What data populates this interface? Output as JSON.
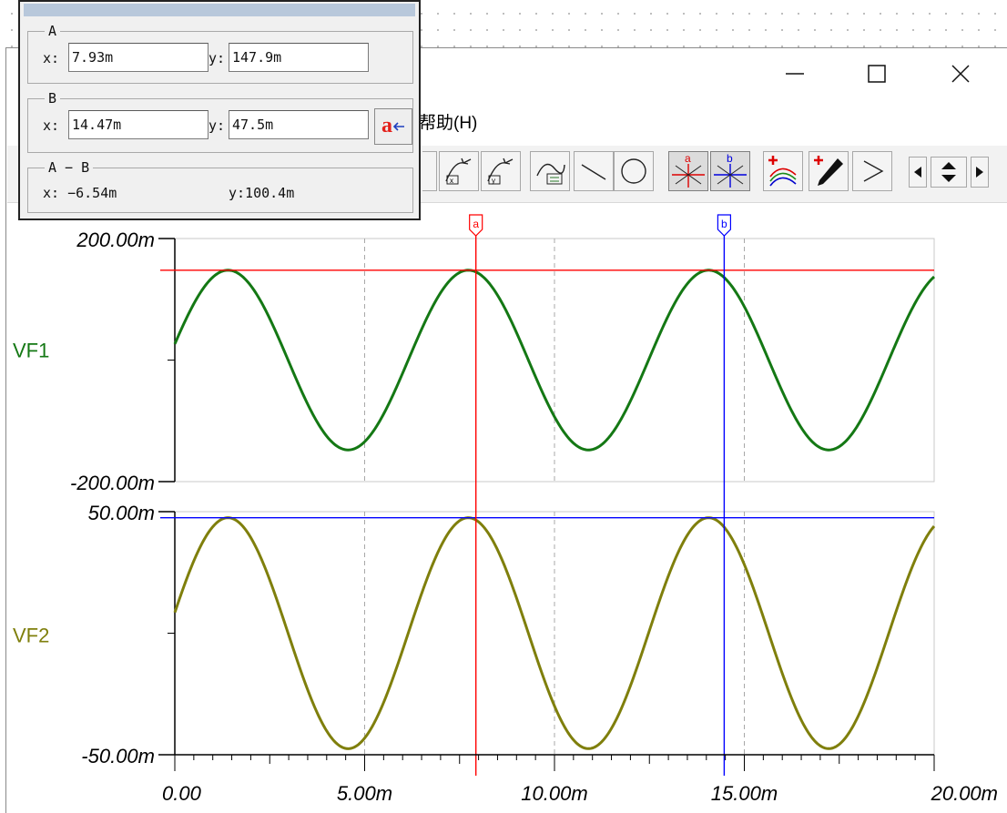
{
  "window": {
    "menu_help": "帮助(H)",
    "minimize_icon": "minimize-icon",
    "maximize_icon": "maximize-icon",
    "close_icon": "close-icon"
  },
  "toolbar": {
    "buttons": [
      "cut-x-icon",
      "cut-y-icon",
      "approx-icon",
      "line-icon",
      "circle-icon",
      "cursor-a-icon",
      "cursor-b-icon",
      "add-trace-icon",
      "probe-icon",
      "play-icon"
    ]
  },
  "cursor_readout": {
    "a": {
      "title": "A",
      "x_label": "x:",
      "x_value": "7.93m",
      "y_label": "y:",
      "y_value": "147.9m"
    },
    "b": {
      "title": "B",
      "x_label": "x:",
      "x_value": "14.47m",
      "y_label": "y:",
      "y_value": "47.5m"
    },
    "diff": {
      "title": "A − B",
      "x_text": "x: −6.54m",
      "y_text": "y:100.4m"
    },
    "set_cursor_label": "a",
    "colors": {
      "label": "#e3201b",
      "arrow": "#1f3fbf"
    }
  },
  "chart_data": {
    "type": "line",
    "x_unit": "s",
    "x_ticks": [
      "0.00",
      "5.00m",
      "10.00m",
      "15.00m",
      "20.00m"
    ],
    "xlim": [
      0,
      0.02
    ],
    "cursors": [
      {
        "name": "a",
        "x": 0.00793,
        "color": "#ff0000",
        "level_VF1": 0.1479
      },
      {
        "name": "b",
        "x": 0.01447,
        "color": "#0000ff",
        "level_VF2": 0.0475
      }
    ],
    "panels": [
      {
        "series": "VF1",
        "color": "#147814",
        "ylim": [
          -0.2,
          0.2
        ],
        "y_ticks": [
          "200.00m",
          "-200.00m"
        ],
        "amplitude": 0.1479,
        "frequency_hz": 158,
        "phase_rad": 0.18,
        "x": [
          0,
          0.001,
          0.002,
          0.003,
          0.004,
          0.005,
          0.006,
          0.007,
          0.008,
          0.009,
          0.01,
          0.011,
          0.012,
          0.013,
          0.014,
          0.015,
          0.016,
          0.017,
          0.018,
          0.019,
          0.02
        ],
        "y": [
          0.027,
          0.136,
          0.135,
          0.025,
          -0.097,
          -0.148,
          -0.088,
          0.039,
          0.143,
          0.128,
          0.011,
          -0.106,
          -0.147,
          -0.078,
          0.051,
          0.146,
          0.121,
          -0.002,
          -0.115,
          -0.144,
          -0.067
        ]
      },
      {
        "series": "VF2",
        "color": "#7f7f0c",
        "ylim": [
          -0.05,
          0.05
        ],
        "y_ticks": [
          "50.00m",
          "-50.00m"
        ],
        "amplitude": 0.0475,
        "frequency_hz": 158,
        "phase_rad": 0.18,
        "x": [
          0,
          0.001,
          0.002,
          0.003,
          0.004,
          0.005,
          0.006,
          0.007,
          0.008,
          0.009,
          0.01,
          0.011,
          0.012,
          0.013,
          0.014,
          0.015,
          0.016,
          0.017,
          0.018,
          0.019,
          0.02
        ],
        "y": [
          0.009,
          0.044,
          0.043,
          0.008,
          -0.031,
          -0.047,
          -0.028,
          0.013,
          0.046,
          0.041,
          0.004,
          -0.034,
          -0.047,
          -0.025,
          0.016,
          0.047,
          0.039,
          -0.001,
          -0.037,
          -0.046,
          -0.021
        ]
      }
    ]
  }
}
